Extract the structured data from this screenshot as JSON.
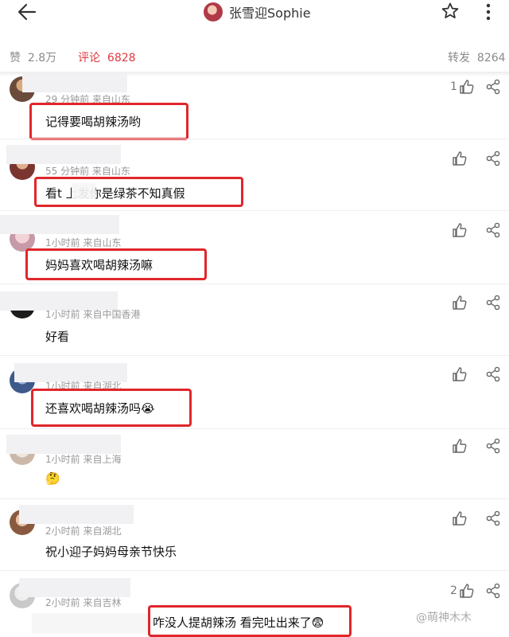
{
  "header": {
    "title": "张雪迎Sophie",
    "back_icon": "arrow-left-icon",
    "star_icon": "star-outline-icon",
    "more_icon": "more-vertical-icon"
  },
  "stats": {
    "like_label": "赞",
    "like_count": "2.8万",
    "comment_label": "评论",
    "comment_count": "6828",
    "repost_label": "转发",
    "repost_count": "8264"
  },
  "colors": {
    "accent": "#e0383e",
    "highlight_box": "#e0262b"
  },
  "comments": [
    {
      "meta": "29 分钟前  来自山东",
      "text": "记得要喝胡辣汤哟",
      "likes": "1"
    },
    {
      "meta": "55 分钟前  来自山东",
      "text": "看t    上发你是绿茶不知真假",
      "likes": ""
    },
    {
      "meta": "1小时前  来自山东",
      "text": "妈妈喜欢喝胡辣汤嘛",
      "likes": ""
    },
    {
      "meta": "1小时前  来自中国香港",
      "text": "好看",
      "likes": ""
    },
    {
      "meta": "1小时前  来自湖北",
      "text": "还喜欢喝胡辣汤吗😭",
      "likes": ""
    },
    {
      "meta": "1小时前  来自上海",
      "text": "🤔",
      "likes": ""
    },
    {
      "meta": "2小时前  来自湖北",
      "text": "祝小迎子妈妈母亲节快乐",
      "likes": ""
    },
    {
      "meta": "2小时前  来自吉林",
      "text": "咋没人提胡辣汤 看完吐出来了😨",
      "likes": "2"
    }
  ],
  "watermark": "@萌神木木"
}
